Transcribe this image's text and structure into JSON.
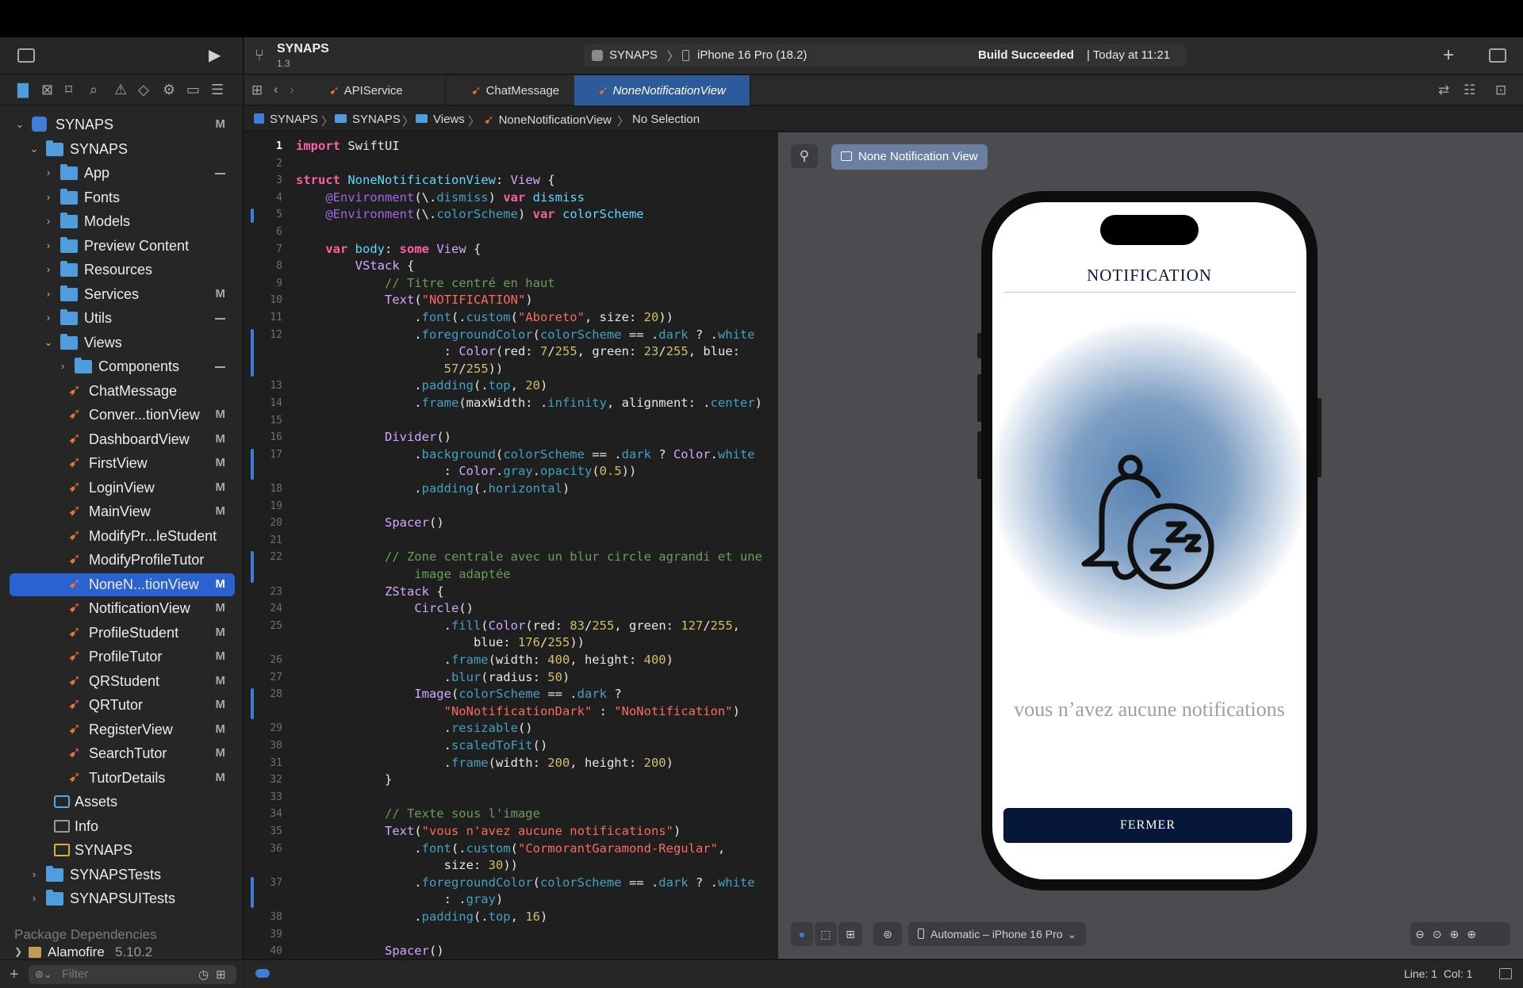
{
  "project": {
    "name": "SYNAPS",
    "version": "1.3"
  },
  "scheme": {
    "target": "SYNAPS",
    "device": "iPhone 16 Pro (18.2)",
    "status_bold": "Build Succeeded",
    "status_rest": "| Today at 11:21"
  },
  "tabs": [
    {
      "label": "APIService",
      "active": false
    },
    {
      "label": "ChatMessage",
      "active": false
    },
    {
      "label": "NoneNotificationView",
      "active": true
    }
  ],
  "breadcrumb": [
    "SYNAPS",
    "SYNAPS",
    "Views",
    "NoneNotificationView",
    "No Selection"
  ],
  "navigator": {
    "items": [
      {
        "label": "SYNAPS",
        "kind": "project",
        "depth": 0,
        "open": true,
        "status": "M"
      },
      {
        "label": "SYNAPS",
        "kind": "folder",
        "depth": 1,
        "open": true,
        "status": ""
      },
      {
        "label": "App",
        "kind": "folder",
        "depth": 2,
        "open": false,
        "status": "—"
      },
      {
        "label": "Fonts",
        "kind": "folder",
        "depth": 2,
        "open": false,
        "status": ""
      },
      {
        "label": "Models",
        "kind": "folder",
        "depth": 2,
        "open": false,
        "status": ""
      },
      {
        "label": "Preview Content",
        "kind": "folder",
        "depth": 2,
        "open": false,
        "status": ""
      },
      {
        "label": "Resources",
        "kind": "folder",
        "depth": 2,
        "open": false,
        "status": ""
      },
      {
        "label": "Services",
        "kind": "folder",
        "depth": 2,
        "open": false,
        "status": "M"
      },
      {
        "label": "Utils",
        "kind": "folder",
        "depth": 2,
        "open": false,
        "status": "—"
      },
      {
        "label": "Views",
        "kind": "folder",
        "depth": 2,
        "open": true,
        "status": ""
      },
      {
        "label": "Components",
        "kind": "folder",
        "depth": 3,
        "open": false,
        "status": "—"
      },
      {
        "label": "ChatMessage",
        "kind": "swift",
        "depth": 3,
        "status": ""
      },
      {
        "label": "Conver...tionView",
        "kind": "swift",
        "depth": 3,
        "status": "M"
      },
      {
        "label": "DashboardView",
        "kind": "swift",
        "depth": 3,
        "status": "M"
      },
      {
        "label": "FirstView",
        "kind": "swift",
        "depth": 3,
        "status": "M"
      },
      {
        "label": "LoginView",
        "kind": "swift",
        "depth": 3,
        "status": "M"
      },
      {
        "label": "MainView",
        "kind": "swift",
        "depth": 3,
        "status": "M"
      },
      {
        "label": "ModifyPr...leStudent",
        "kind": "swift",
        "depth": 3,
        "status": ""
      },
      {
        "label": "ModifyProfileTutor",
        "kind": "swift",
        "depth": 3,
        "status": ""
      },
      {
        "label": "NoneN...tionView",
        "kind": "swift",
        "depth": 3,
        "status": "M",
        "selected": true
      },
      {
        "label": "NotificationView",
        "kind": "swift",
        "depth": 3,
        "status": "M"
      },
      {
        "label": "ProfileStudent",
        "kind": "swift",
        "depth": 3,
        "status": "M"
      },
      {
        "label": "ProfileTutor",
        "kind": "swift",
        "depth": 3,
        "status": "M"
      },
      {
        "label": "QRStudent",
        "kind": "swift",
        "depth": 3,
        "status": "M"
      },
      {
        "label": "QRTutor",
        "kind": "swift",
        "depth": 3,
        "status": "M"
      },
      {
        "label": "RegisterView",
        "kind": "swift",
        "depth": 3,
        "status": "M"
      },
      {
        "label": "SearchTutor",
        "kind": "swift",
        "depth": 3,
        "status": "M"
      },
      {
        "label": "TutorDetails",
        "kind": "swift",
        "depth": 3,
        "status": "M"
      },
      {
        "label": "Assets",
        "kind": "assets",
        "depth": 2,
        "status": ""
      },
      {
        "label": "Info",
        "kind": "plist",
        "depth": 2,
        "status": ""
      },
      {
        "label": "SYNAPS",
        "kind": "entitlements",
        "depth": 2,
        "status": ""
      },
      {
        "label": "SYNAPSTests",
        "kind": "folder",
        "depth": 1,
        "open": false,
        "status": ""
      },
      {
        "label": "SYNAPSUITests",
        "kind": "folder",
        "depth": 1,
        "open": false,
        "status": ""
      }
    ],
    "package_header": "Package Dependencies",
    "package": {
      "name": "Alamofire",
      "version": "5.10.2"
    },
    "filter_placeholder": "Filter"
  },
  "code_lines": [
    {
      "n": "1",
      "html": "<span class='k'>import</span> SwiftUI"
    },
    {
      "n": "2",
      "html": ""
    },
    {
      "n": "3",
      "html": "<span class='k'>struct</span> <span class='t'>NoneNotificationView</span>: <span class='ty'>View</span> {"
    },
    {
      "n": "4",
      "html": "    <span class='f'>@Environment</span>(\\.<span class='p'>dismiss</span>) <span class='k'>var</span> <span class='t'>dismiss</span>"
    },
    {
      "n": "5",
      "html": "    <span class='f'>@Environment</span>(\\.<span class='p'>colorScheme</span>) <span class='k'>var</span> <span class='t'>colorScheme</span>"
    },
    {
      "n": "6",
      "html": ""
    },
    {
      "n": "7",
      "html": "    <span class='k'>var</span> <span class='t'>body</span>: <span class='k'>some</span> <span class='ty'>View</span> {"
    },
    {
      "n": "8",
      "html": "        <span class='ty'>VStack</span> {"
    },
    {
      "n": "9",
      "html": "            <span class='c'>// Titre centré en haut</span>"
    },
    {
      "n": "10",
      "html": "            <span class='ty'>Text</span>(<span class='s'>\"NOTIFICATION\"</span>)"
    },
    {
      "n": "11",
      "html": "                .<span class='p'>font</span>(.<span class='p'>custom</span>(<span class='s'>\"Aboreto\"</span>, size: <span class='n'>20</span>))"
    },
    {
      "n": "12",
      "html": "                .<span class='p'>foregroundColor</span>(<span class='p'>colorScheme</span> == .<span class='p'>dark</span> ? .<span class='p'>white</span>"
    },
    {
      "n": "",
      "html": "                    : <span class='ty'>Color</span>(red: <span class='n'>7</span>/<span class='n'>255</span>, green: <span class='n'>23</span>/<span class='n'>255</span>, blue:"
    },
    {
      "n": "",
      "html": "                    <span class='n'>57</span>/<span class='n'>255</span>))"
    },
    {
      "n": "13",
      "html": "                .<span class='p'>padding</span>(.<span class='p'>top</span>, <span class='n'>20</span>)"
    },
    {
      "n": "14",
      "html": "                .<span class='p'>frame</span>(maxWidth: .<span class='p'>infinity</span>, alignment: .<span class='p'>center</span>)"
    },
    {
      "n": "15",
      "html": ""
    },
    {
      "n": "16",
      "html": "            <span class='ty'>Divider</span>()"
    },
    {
      "n": "17",
      "html": "                .<span class='p'>background</span>(<span class='p'>colorScheme</span> == .<span class='p'>dark</span> ? <span class='ty'>Color</span>.<span class='p'>white</span>"
    },
    {
      "n": "",
      "html": "                    : <span class='ty'>Color</span>.<span class='p'>gray</span>.<span class='p'>opacity</span>(<span class='n'>0.5</span>))"
    },
    {
      "n": "18",
      "html": "                .<span class='p'>padding</span>(.<span class='p'>horizontal</span>)"
    },
    {
      "n": "19",
      "html": ""
    },
    {
      "n": "20",
      "html": "            <span class='ty'>Spacer</span>()"
    },
    {
      "n": "21",
      "html": ""
    },
    {
      "n": "22",
      "html": "            <span class='c'>// Zone centrale avec un blur circle agrandi et une</span>"
    },
    {
      "n": "",
      "html": "<span class='c'>                image adaptée</span>"
    },
    {
      "n": "23",
      "html": "            <span class='ty'>ZStack</span> {"
    },
    {
      "n": "24",
      "html": "                <span class='ty'>Circle</span>()"
    },
    {
      "n": "25",
      "html": "                    .<span class='p'>fill</span>(<span class='ty'>Color</span>(red: <span class='n'>83</span>/<span class='n'>255</span>, green: <span class='n'>127</span>/<span class='n'>255</span>,"
    },
    {
      "n": "",
      "html": "                        blue: <span class='n'>176</span>/<span class='n'>255</span>))"
    },
    {
      "n": "26",
      "html": "                    .<span class='p'>frame</span>(width: <span class='n'>400</span>, height: <span class='n'>400</span>)"
    },
    {
      "n": "27",
      "html": "                    .<span class='p'>blur</span>(radius: <span class='n'>50</span>)"
    },
    {
      "n": "28",
      "html": "                <span class='ty'>Image</span>(<span class='p'>colorScheme</span> == .<span class='p'>dark</span> ?"
    },
    {
      "n": "",
      "html": "                    <span class='s'>\"NoNotificationDark\"</span> : <span class='s'>\"NoNotification\"</span>)"
    },
    {
      "n": "29",
      "html": "                    .<span class='p'>resizable</span>()"
    },
    {
      "n": "30",
      "html": "                    .<span class='p'>scaledToFit</span>()"
    },
    {
      "n": "31",
      "html": "                    .<span class='p'>frame</span>(width: <span class='n'>200</span>, height: <span class='n'>200</span>)"
    },
    {
      "n": "32",
      "html": "            }"
    },
    {
      "n": "33",
      "html": ""
    },
    {
      "n": "34",
      "html": "            <span class='c'>// Texte sous l'image</span>"
    },
    {
      "n": "35",
      "html": "            <span class='ty'>Text</span>(<span class='s'>\"vous n'avez aucune notifications\"</span>)"
    },
    {
      "n": "36",
      "html": "                .<span class='p'>font</span>(.<span class='p'>custom</span>(<span class='s'>\"CormorantGaramond-Regular\"</span>,"
    },
    {
      "n": "",
      "html": "                    size: <span class='n'>30</span>))"
    },
    {
      "n": "37",
      "html": "                .<span class='p'>foregroundColor</span>(<span class='p'>colorScheme</span> == .<span class='p'>dark</span> ? .<span class='p'>white</span>"
    },
    {
      "n": "",
      "html": "                    : .<span class='p'>gray</span>)"
    },
    {
      "n": "38",
      "html": "                .<span class='p'>padding</span>(.<span class='p'>top</span>, <span class='n'>16</span>)"
    },
    {
      "n": "39",
      "html": ""
    },
    {
      "n": "40",
      "html": "            <span class='ty'>Spacer</span>()"
    }
  ],
  "canvas": {
    "preview_label": "None Notification View",
    "device_menu": "Automatic – iPhone 16 Pro",
    "app": {
      "title": "NOTIFICATION",
      "message": "vous n’avez aucune notifications",
      "button": "FERMER",
      "glow_color": "#537FB0",
      "button_color": "#071739"
    }
  },
  "status": {
    "position": "Line: 1  Col: 1"
  },
  "colors": {
    "selection": "#2A62D0",
    "swift_icon": "#F1703A",
    "folder": "#4F9CDF"
  }
}
